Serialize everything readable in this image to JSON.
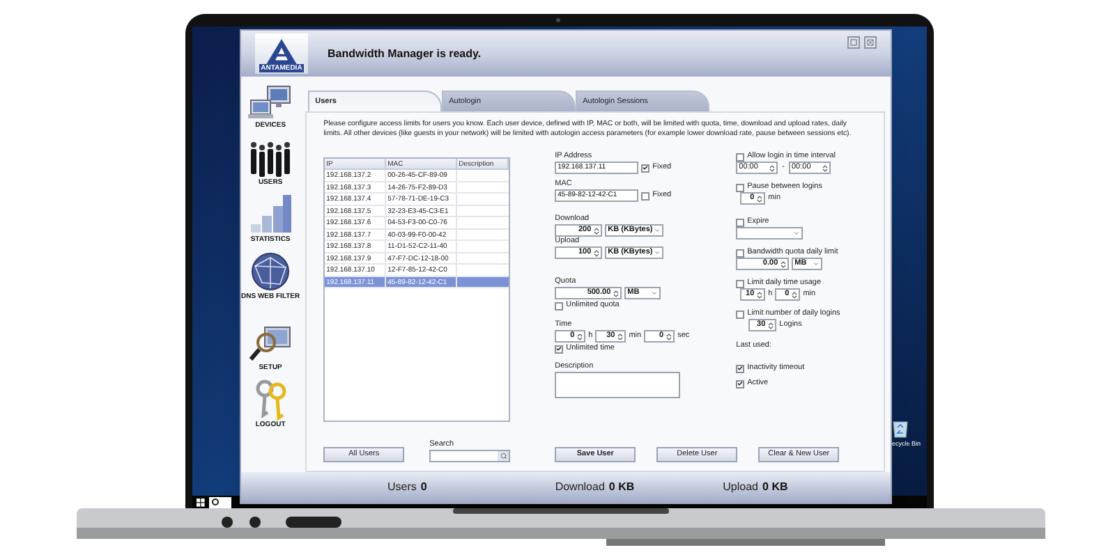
{
  "app": {
    "logo_text": "ANTAMEDIA",
    "title": "Bandwidth Manager is ready."
  },
  "sidebar": [
    {
      "kind": "devices",
      "label": "DEVICES"
    },
    {
      "kind": "users",
      "label": "USERS"
    },
    {
      "kind": "statistics",
      "label": "STATISTICS"
    },
    {
      "kind": "globe",
      "label": "DNS WEB FILTER"
    },
    {
      "kind": "setup",
      "label": "SETUP"
    },
    {
      "kind": "logout",
      "label": "LOGOUT"
    }
  ],
  "tabs": [
    {
      "label": "Users",
      "selected": true
    },
    {
      "label": "Autologin",
      "selected": false
    },
    {
      "label": "Autologin Sessions",
      "selected": false
    }
  ],
  "intro": "Please configure access limits for users you know. Each user device, defined with IP, MAC or both, will be limited with quota, time, download and upload rates, daily limits. All other devices (like guests in your network) will be limited with autologin access parameters (for example lower download rate, pause between sessions etc).",
  "users_table": {
    "columns": [
      "IP",
      "MAC",
      "Description"
    ],
    "rows": [
      {
        "ip": "192.168.137.2",
        "mac": "00-26-45-CF-89-09",
        "selected": false
      },
      {
        "ip": "192.168.137.3",
        "mac": "14-26-75-F2-89-D3",
        "selected": false
      },
      {
        "ip": "192.168.137.4",
        "mac": "57-78-71-DE-19-C3",
        "selected": false
      },
      {
        "ip": "192.168.137.5",
        "mac": "32-23-E3-45-C3-E1",
        "selected": false
      },
      {
        "ip": "192.168.137.6",
        "mac": "04-53-F3-00-C0-76",
        "selected": false
      },
      {
        "ip": "192.168.137.7",
        "mac": "40-03-99-F0-00-42",
        "selected": false
      },
      {
        "ip": "192.168.137.8",
        "mac": "11-D1-52-C2-11-40",
        "selected": false
      },
      {
        "ip": "192.168.137.9",
        "mac": "47-F7-DC-12-18-00",
        "selected": false
      },
      {
        "ip": "192.168.137.10",
        "mac": "12-F7-85-12-42-C0",
        "selected": false
      },
      {
        "ip": "192.168.137.11",
        "mac": "45-89-82-12-42-C1",
        "selected": true
      }
    ]
  },
  "all_users_button": "All Users",
  "search": {
    "label": "Search"
  },
  "form": {
    "ip": {
      "label": "IP Address",
      "value": "192.168.137.11",
      "fixed_label": "Fixed",
      "fixed": true
    },
    "mac": {
      "label": "MAC",
      "value": "45-89-82-12-42-C1",
      "fixed_label": "Fixed",
      "fixed": false
    },
    "download": {
      "label": "Download",
      "value": "200",
      "unit": "KB (KBytes)"
    },
    "upload": {
      "label": "Upload",
      "value": "100",
      "unit": "KB (KBytes)"
    },
    "quota": {
      "label": "Quota",
      "value": "500.00",
      "unit": "MB",
      "unlimited_label": "Unlimited quota",
      "unlimited": false
    },
    "time": {
      "label": "Time",
      "hours": "0",
      "h": "h",
      "minutes": "30",
      "min": "min",
      "seconds": "0",
      "sec": "sec",
      "unlimited_label": "Unlimited time",
      "unlimited": true
    },
    "description": {
      "label": "Description"
    }
  },
  "limits": {
    "interval": {
      "label": "Allow login in time interval",
      "checked": false,
      "from": "00:00",
      "separator": "-",
      "to": "00:00"
    },
    "pause": {
      "label": "Pause between logins",
      "checked": false,
      "value": "0",
      "unit": "min"
    },
    "expire": {
      "label": "Expire",
      "checked": false
    },
    "daily_quota": {
      "label": "Bandwidth quota daily limit",
      "checked": false,
      "value": "0.00",
      "unit": "MB"
    },
    "daily_time": {
      "label": "Limit daily time usage",
      "checked": false,
      "hours": "10",
      "h": "h",
      "minutes": "0",
      "min": "min"
    },
    "daily_logins": {
      "label": "Limit number of daily logins",
      "checked": false,
      "value": "30",
      "unit": "Logins"
    },
    "last_used": "Last used:",
    "inactivity": {
      "label": "Inactivity timeout",
      "checked": true
    },
    "active": {
      "label": "Active",
      "checked": true
    }
  },
  "buttons": [
    {
      "label": "Save User",
      "primary": true
    },
    {
      "label": "Delete User",
      "primary": false
    },
    {
      "label": "Clear & New User",
      "primary": false
    }
  ],
  "status": [
    {
      "label": "Users",
      "value": "0"
    },
    {
      "label": "Download",
      "value": "0 KB"
    },
    {
      "label": "Upload",
      "value": "0 KB"
    }
  ],
  "desktop": {
    "recycle_bin": "ecycle Bin"
  }
}
